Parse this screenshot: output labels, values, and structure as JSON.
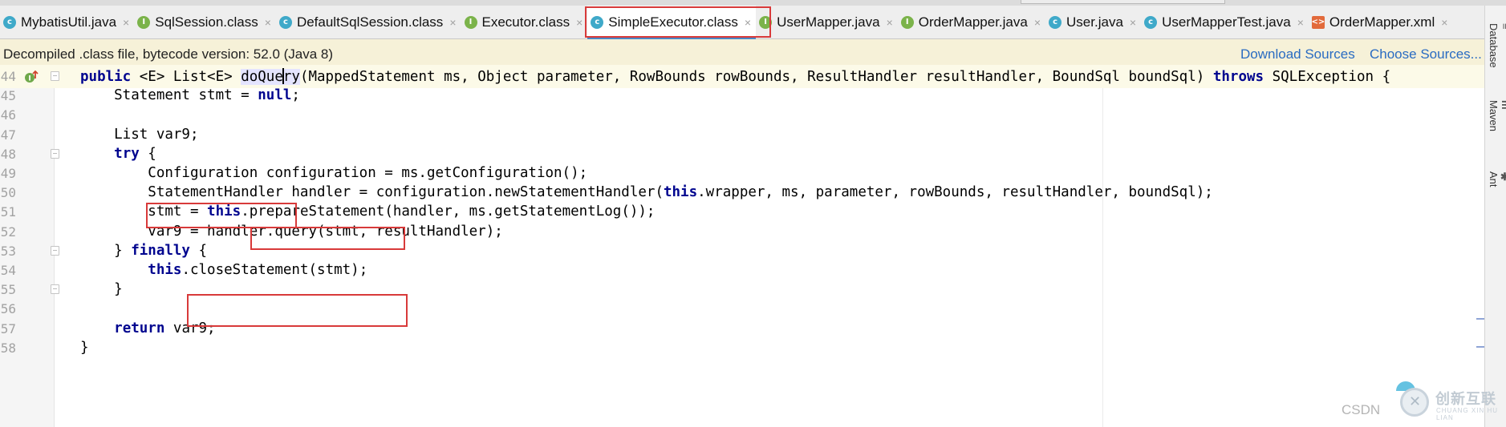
{
  "tabs": [
    {
      "label": "MybatisUtil.java",
      "icon": "class-icon",
      "active": false
    },
    {
      "label": "SqlSession.class",
      "icon": "interface-icon",
      "active": false
    },
    {
      "label": "DefaultSqlSession.class",
      "icon": "class-icon",
      "active": false
    },
    {
      "label": "Executor.class",
      "icon": "interface-icon",
      "active": false
    },
    {
      "label": "SimpleExecutor.class",
      "icon": "class-icon",
      "active": true
    },
    {
      "label": "UserMapper.java",
      "icon": "interface-icon",
      "active": false
    },
    {
      "label": "OrderMapper.java",
      "icon": "interface-icon",
      "active": false
    },
    {
      "label": "User.java",
      "icon": "class-icon",
      "active": false
    },
    {
      "label": "UserMapperTest.java",
      "icon": "class-icon",
      "active": false
    },
    {
      "label": "OrderMapper.xml",
      "icon": "xml-icon",
      "active": false
    }
  ],
  "tab_close_glyph": "×",
  "banner": {
    "message": "Decompiled .class file, bytecode version: 52.0 (Java 8)",
    "download_sources": "Download Sources",
    "choose_sources": "Choose Sources..."
  },
  "right_tools": [
    "Database",
    "Maven",
    "Ant"
  ],
  "code_lines": [
    {
      "num": "44",
      "text": "public <E> List<E> doQuery(MappedStatement ms, Object parameter, RowBounds rowBounds, ResultHandler resultHandler, BoundSql boundSql) throws SQLException {"
    },
    {
      "num": "45",
      "text": "    Statement stmt = null;"
    },
    {
      "num": "46",
      "text": ""
    },
    {
      "num": "47",
      "text": "    List var9;"
    },
    {
      "num": "48",
      "text": "    try {"
    },
    {
      "num": "49",
      "text": "        Configuration configuration = ms.getConfiguration();"
    },
    {
      "num": "50",
      "text": "        StatementHandler handler = configuration.newStatementHandler(this.wrapper, ms, parameter, rowBounds, resultHandler, boundSql);"
    },
    {
      "num": "51",
      "text": "        stmt = this.prepareStatement(handler, ms.getStatementLog());"
    },
    {
      "num": "52",
      "text": "        var9 = handler.query(stmt, resultHandler);"
    },
    {
      "num": "53",
      "text": "    } finally {"
    },
    {
      "num": "54",
      "text": "        this.closeStatement(stmt);"
    },
    {
      "num": "55",
      "text": "    }"
    },
    {
      "num": "56",
      "text": ""
    },
    {
      "num": "57",
      "text": "    return var9;"
    },
    {
      "num": "58",
      "text": "}"
    }
  ],
  "watermark": {
    "csdn": "CSDN",
    "brand": "创新互联",
    "brand_sub": "CHUANG XIN HU LIAN"
  },
  "colors": {
    "keyword": "#00058f",
    "annotation_box": "#d83a3a",
    "banner_bg": "#f6f1d8",
    "link": "#2a6cc2",
    "active_tab_underline": "#4a88c7"
  }
}
